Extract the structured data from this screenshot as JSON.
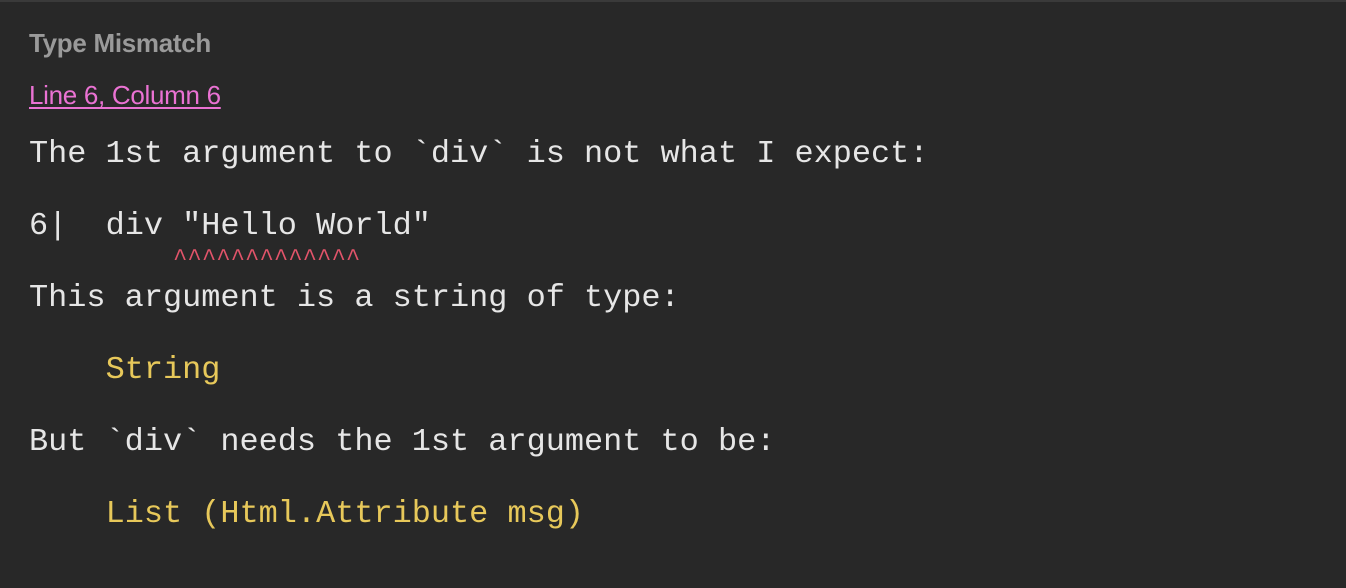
{
  "error": {
    "title": "Type Mismatch",
    "location_link": "Line 6, Column 6",
    "message_intro": "The 1st argument to `div` is not what I expect:",
    "code_snippet": {
      "line_number": "6|",
      "code_prefix": "div ",
      "code_highlight": "\"Hello World\"",
      "carets": "^^^^^^^^^^^^^"
    },
    "actual_intro": "This argument is a string of type:",
    "actual_type": "String",
    "expected_intro": "But `div` needs the 1st argument to be:",
    "expected_type": "List (Html.Attribute msg)"
  },
  "colors": {
    "background": "#282828",
    "title": "#9a9a9a",
    "link": "#ea72d3",
    "text": "#e6e6e6",
    "type_highlight": "#e7c85a",
    "error_underline": "#e2546a"
  }
}
